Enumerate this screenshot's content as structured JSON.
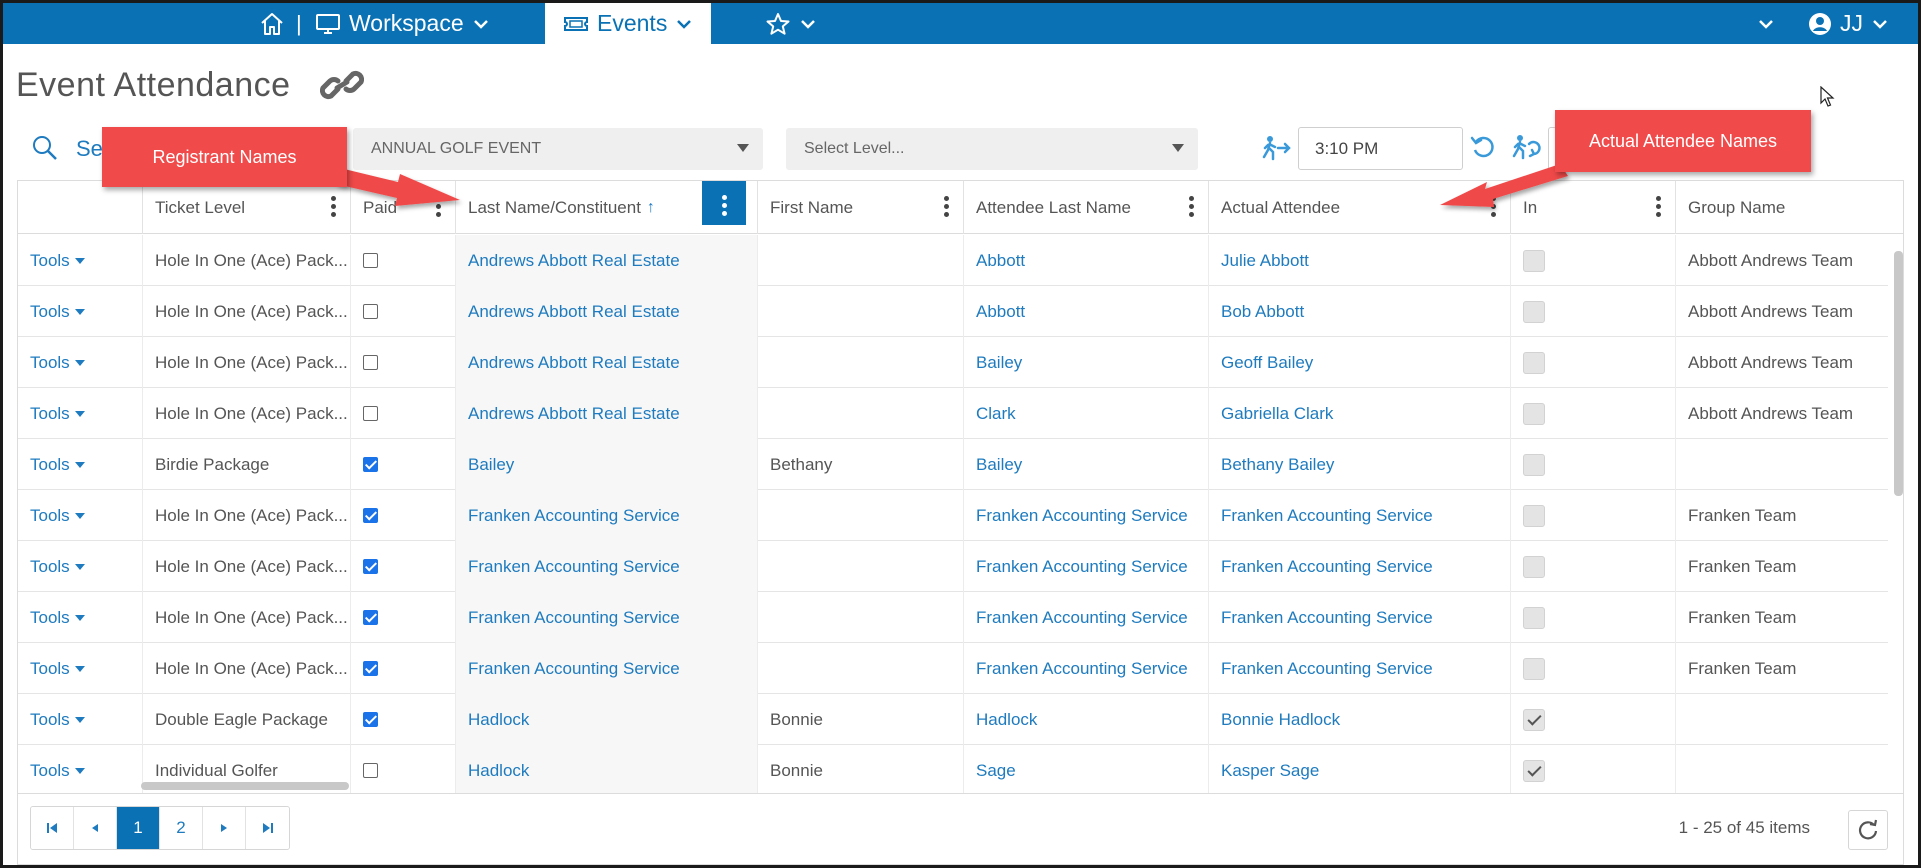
{
  "nav": {
    "workspace_label": "Workspace",
    "events_label": "Events",
    "separator": "|",
    "user_initials": "JJ"
  },
  "page": {
    "title": "Event Attendance"
  },
  "toolbar": {
    "search_label": "Se",
    "event_select": "ANNUAL GOLF EVENT",
    "level_placeholder": "Select Level...",
    "time_value": "3:10 PM"
  },
  "grid": {
    "columns": {
      "ticket_level": "Ticket Level",
      "paid": "Paid",
      "last_name": "Last Name/Constituent",
      "sort_indicator": "↑",
      "first_name": "First Name",
      "attendee_last_name": "Attendee Last Name",
      "actual_attendee": "Actual Attendee",
      "in": "In",
      "group_name": "Group Name"
    },
    "tools_label": "Tools",
    "rows": [
      {
        "ticket": "Hole In One (Ace) Pack...",
        "paid": false,
        "last": "Andrews Abbott Real Estate",
        "first": "",
        "att_last": "Abbott",
        "actual": "Julie Abbott",
        "in": false,
        "group": "Abbott Andrews Team"
      },
      {
        "ticket": "Hole In One (Ace) Pack...",
        "paid": false,
        "last": "Andrews Abbott Real Estate",
        "first": "",
        "att_last": "Abbott",
        "actual": "Bob Abbott",
        "in": false,
        "group": "Abbott Andrews Team"
      },
      {
        "ticket": "Hole In One (Ace) Pack...",
        "paid": false,
        "last": "Andrews Abbott Real Estate",
        "first": "",
        "att_last": "Bailey",
        "actual": "Geoff Bailey",
        "in": false,
        "group": "Abbott Andrews Team"
      },
      {
        "ticket": "Hole In One (Ace) Pack...",
        "paid": false,
        "last": "Andrews Abbott Real Estate",
        "first": "",
        "att_last": "Clark",
        "actual": "Gabriella Clark",
        "in": false,
        "group": "Abbott Andrews Team"
      },
      {
        "ticket": "Birdie Package",
        "paid": true,
        "last": "Bailey",
        "first": "Bethany",
        "att_last": "Bailey",
        "actual": "Bethany Bailey",
        "in": false,
        "group": ""
      },
      {
        "ticket": "Hole In One (Ace) Pack...",
        "paid": true,
        "last": "Franken Accounting Service",
        "first": "",
        "att_last": "Franken Accounting Service",
        "actual": "Franken Accounting Service",
        "in": false,
        "group": "Franken Team"
      },
      {
        "ticket": "Hole In One (Ace) Pack...",
        "paid": true,
        "last": "Franken Accounting Service",
        "first": "",
        "att_last": "Franken Accounting Service",
        "actual": "Franken Accounting Service",
        "in": false,
        "group": "Franken Team"
      },
      {
        "ticket": "Hole In One (Ace) Pack...",
        "paid": true,
        "last": "Franken Accounting Service",
        "first": "",
        "att_last": "Franken Accounting Service",
        "actual": "Franken Accounting Service",
        "in": false,
        "group": "Franken Team"
      },
      {
        "ticket": "Hole In One (Ace) Pack...",
        "paid": true,
        "last": "Franken Accounting Service",
        "first": "",
        "att_last": "Franken Accounting Service",
        "actual": "Franken Accounting Service",
        "in": false,
        "group": "Franken Team"
      },
      {
        "ticket": "Double Eagle Package",
        "paid": true,
        "last": "Hadlock",
        "first": "Bonnie",
        "att_last": "Hadlock",
        "actual": "Bonnie Hadlock",
        "in": true,
        "group": ""
      },
      {
        "ticket": "Individual Golfer",
        "paid": false,
        "last": "Hadlock",
        "first": "Bonnie",
        "att_last": "Sage",
        "actual": "Kasper Sage",
        "in": true,
        "group": ""
      }
    ]
  },
  "pager": {
    "pages": [
      "1",
      "2"
    ],
    "current_page": "1",
    "info": "1 - 25 of 45 items"
  },
  "annotations": {
    "registrant": "Registrant Names",
    "attendee": "Actual Attendee Names",
    "color": "#f04a4a"
  },
  "colors": {
    "brand": "#0a72b4",
    "link": "#1e7bbf"
  }
}
